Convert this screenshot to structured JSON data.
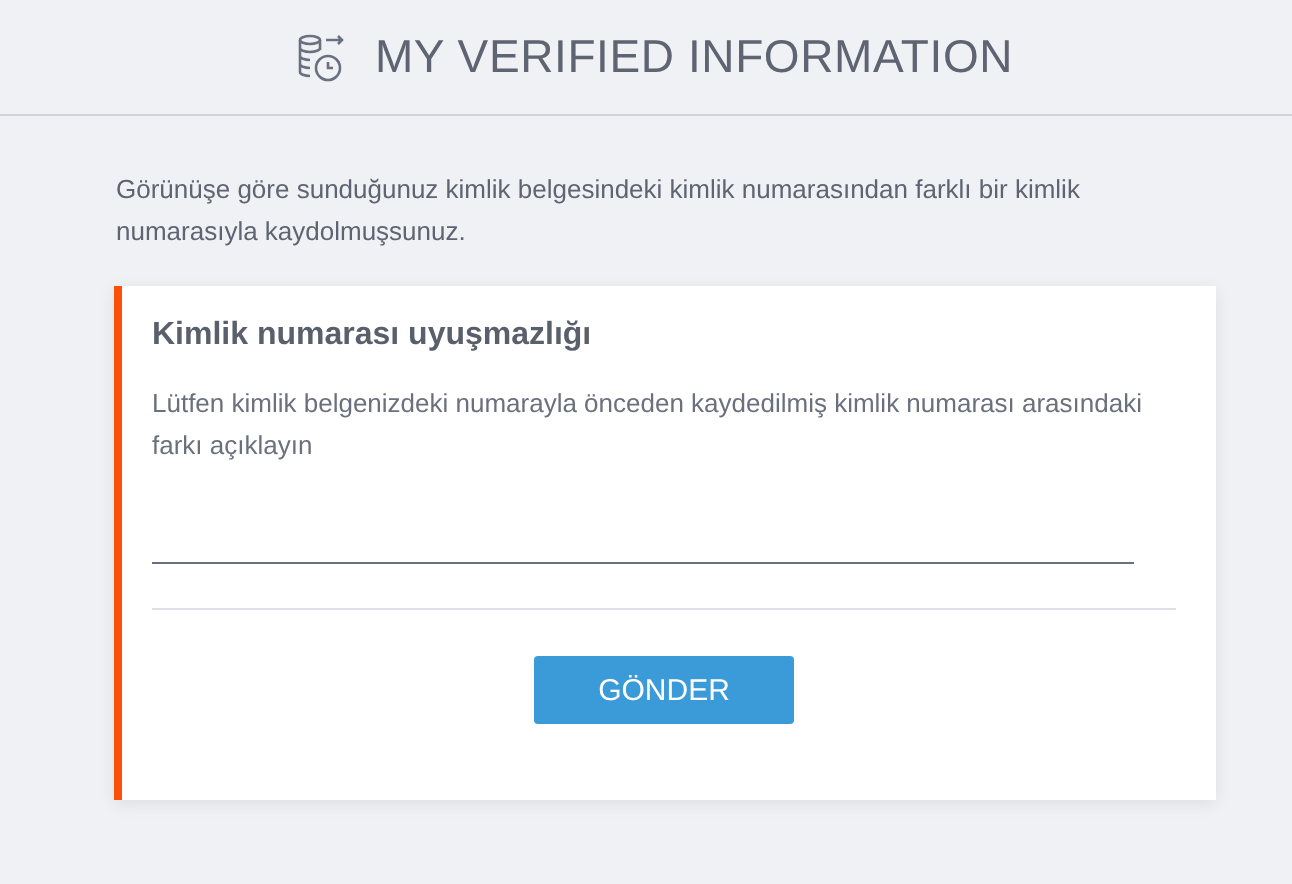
{
  "header": {
    "title": "MY VERIFIED INFORMATION"
  },
  "intro": "Görünüşe göre sunduğunuz kimlik belgesindeki kimlik numarasından farklı bir kimlik numarasıyla kaydolmuşsunuz.",
  "card": {
    "title": "Kimlik numarası uyuşmazlığı",
    "description": "Lütfen kimlik belgenizdeki numarayla önceden kaydedilmiş kimlik numarası arasındaki farkı açıklayın",
    "submit": "GÖNDER"
  }
}
